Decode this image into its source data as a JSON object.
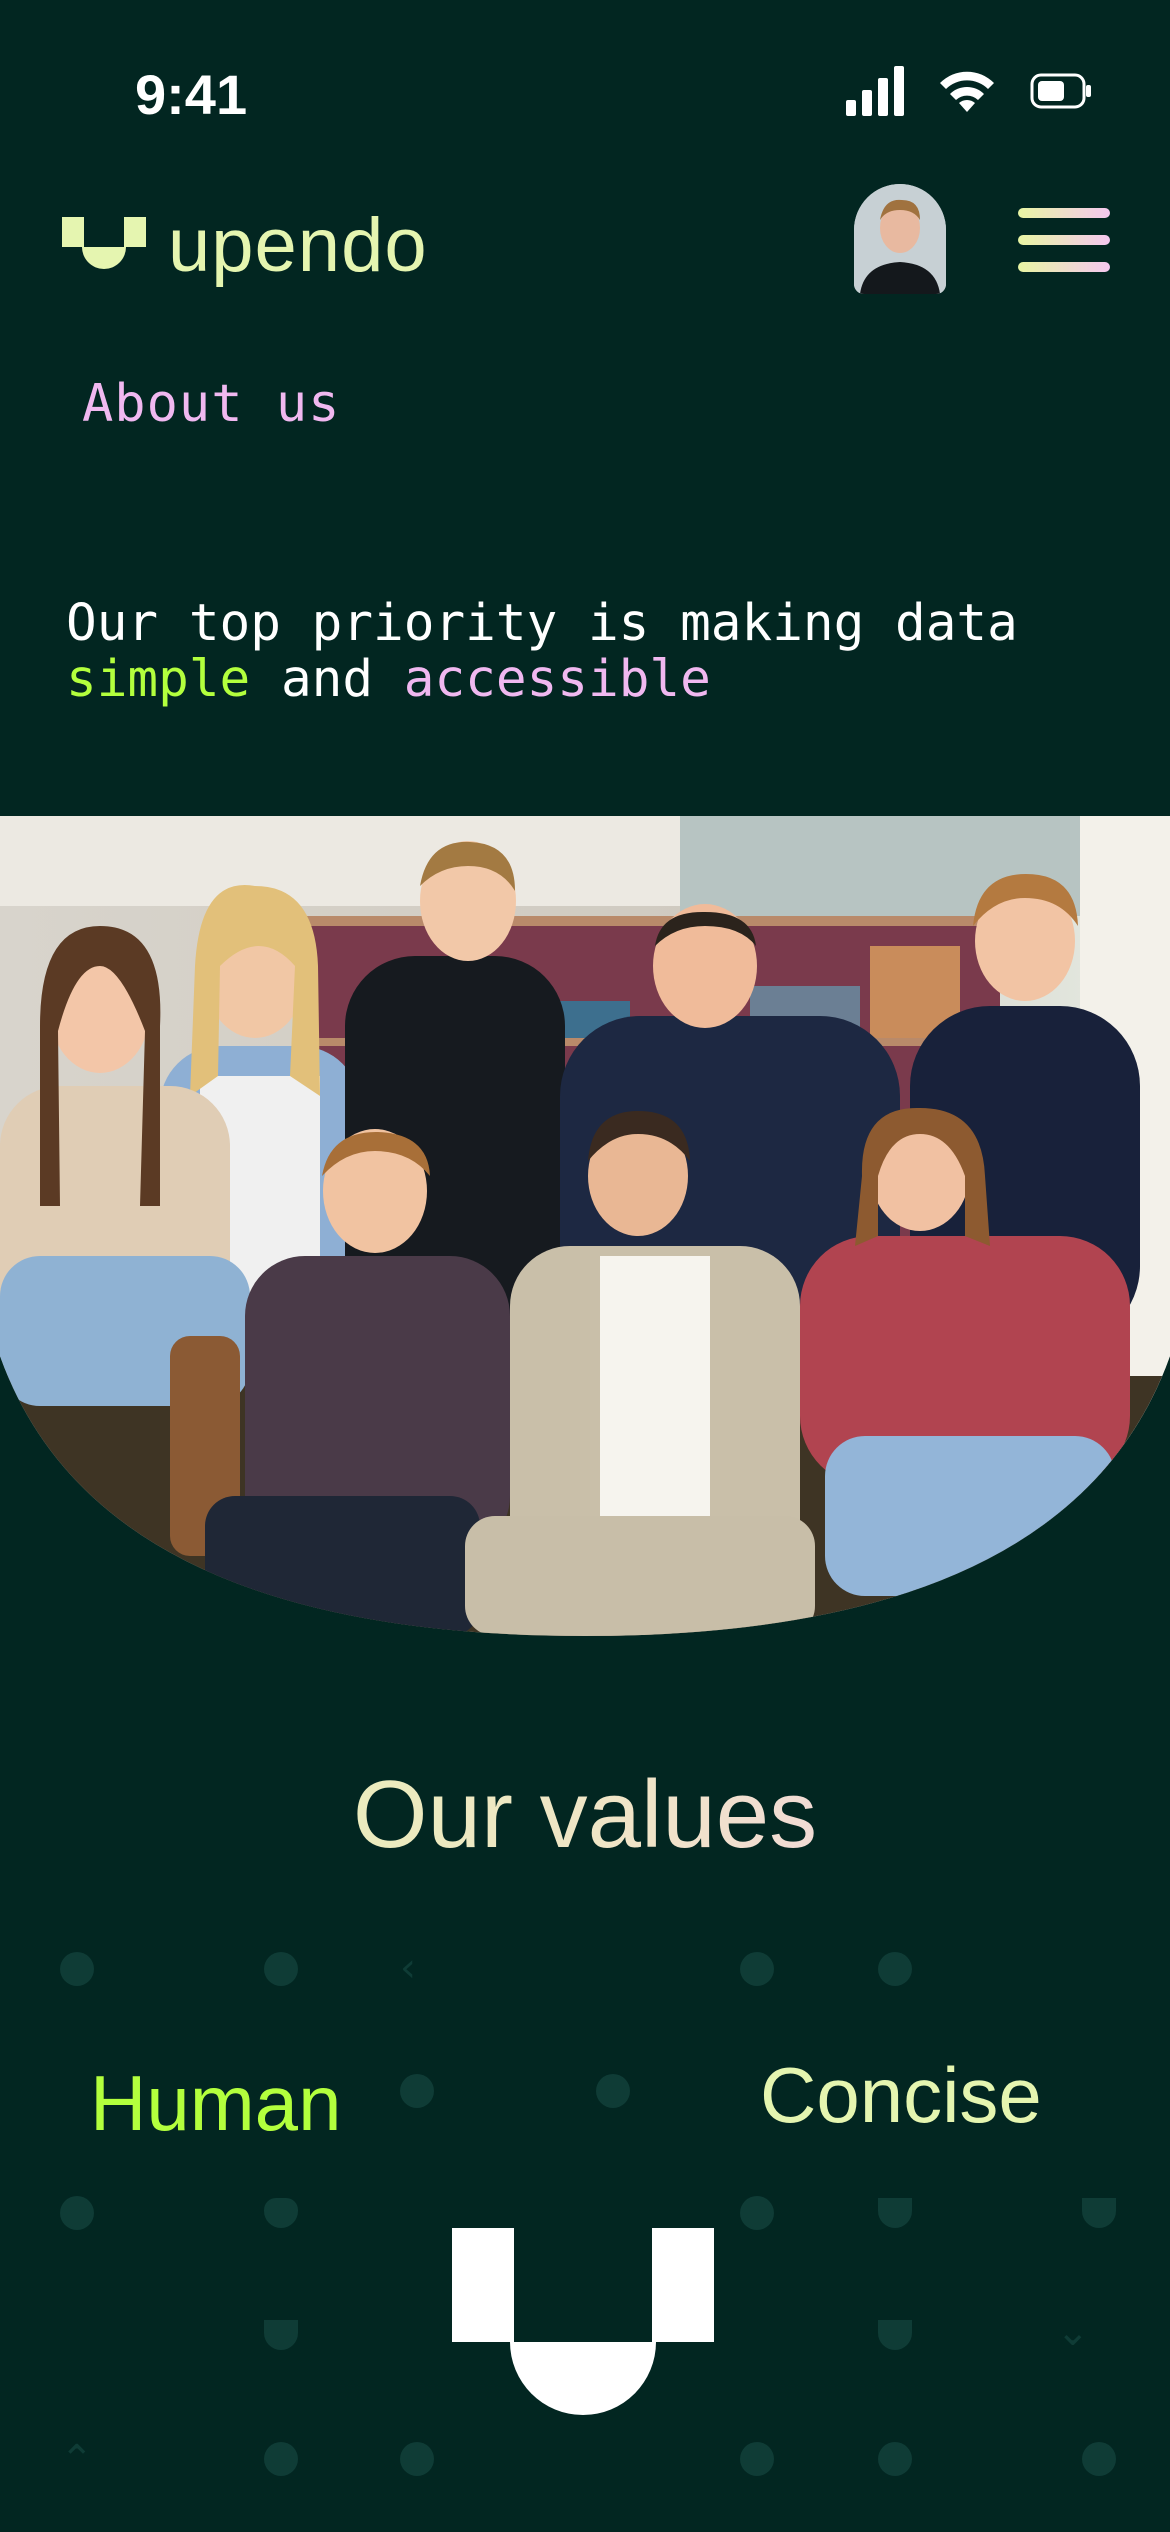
{
  "status_bar": {
    "time": "9:41",
    "icons": [
      "signal-icon",
      "wifi-icon",
      "battery-icon"
    ]
  },
  "header": {
    "logo_text": "upendo",
    "avatar_alt": "profile-avatar",
    "menu_icon": "hamburger-menu-icon"
  },
  "page": {
    "section_label": "About us",
    "tagline_part1": "Our top priority is making data",
    "tagline_highlight1": "simple",
    "tagline_and": " and ",
    "tagline_highlight2": "accessible"
  },
  "values": {
    "title": "Our values",
    "items": [
      "Human",
      "Concise"
    ]
  },
  "colors": {
    "background": "#022621",
    "accent_green": "#b3ff3d",
    "accent_pink": "#f0b8f0",
    "accent_cream": "#e5f5b0"
  }
}
